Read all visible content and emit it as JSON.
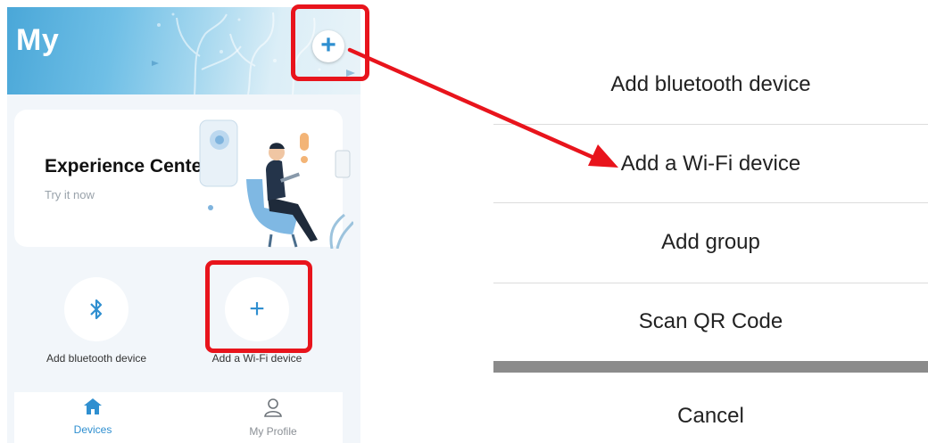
{
  "header": {
    "title": "My",
    "add_icon": "plus-icon"
  },
  "experience_card": {
    "title": "Experience Center",
    "subtitle": "Try it now"
  },
  "quick_actions": [
    {
      "label": "Add bluetooth device",
      "icon": "bluetooth-icon"
    },
    {
      "label": "Add a Wi-Fi device",
      "icon": "plus-icon"
    }
  ],
  "tabbar": {
    "tabs": [
      {
        "label": "Devices",
        "icon": "home-icon",
        "active": true
      },
      {
        "label": "My Profile",
        "icon": "person-icon",
        "active": false
      }
    ]
  },
  "action_sheet": {
    "items": [
      {
        "label": "Add bluetooth device"
      },
      {
        "label": "Add a Wi-Fi device"
      },
      {
        "label": "Add group"
      },
      {
        "label": "Scan QR Code"
      }
    ],
    "cancel_label": "Cancel"
  },
  "colors": {
    "accent": "#2f8fd0",
    "highlight": "#e8141c",
    "sheet_gap": "#8b8b8b"
  }
}
